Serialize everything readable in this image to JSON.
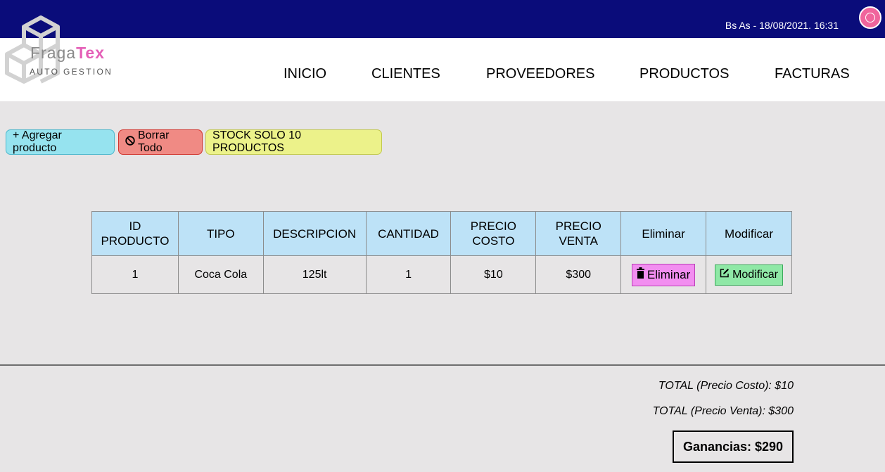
{
  "header": {
    "datetime": "Bs As - 18/08/2021. 16:31",
    "logout_icon": "power-icon",
    "accent_color": "#0a0c7a"
  },
  "logo": {
    "name_part1": "Fraga",
    "name_part2": "Tex",
    "subtitle": "AUTO GESTION"
  },
  "nav": {
    "items": [
      {
        "label": "INICIO"
      },
      {
        "label": "CLIENTES"
      },
      {
        "label": "PROVEEDORES"
      },
      {
        "label": "PRODUCTOS"
      },
      {
        "label": "FACTURAS"
      }
    ]
  },
  "toolbar": {
    "add_label": "+ Agregar producto",
    "clear_icon": "prohibited-icon",
    "clear_label": "Borrar Todo",
    "stock_label": "STOCK SOLO 10 PRODUCTOS"
  },
  "table": {
    "headers": {
      "id_line1": "ID",
      "id_line2": "PRODUCTO",
      "tipo": "TIPO",
      "descripcion": "DESCRIPCION",
      "cantidad": "CANTIDAD",
      "costo_line1": "PRECIO",
      "costo_line2": "COSTO",
      "venta_line1": "PRECIO",
      "venta_line2": "VENTA",
      "eliminar": "Eliminar",
      "modificar": "Modificar"
    },
    "rows": [
      {
        "id": "1",
        "tipo": "Coca Cola",
        "descripcion": "125lt",
        "cantidad": "1",
        "precio_costo": "$10",
        "precio_venta": "$300",
        "delete_label": "Eliminar",
        "delete_icon": "trash-icon",
        "edit_label": "Modificar",
        "edit_icon": "edit-icon"
      }
    ]
  },
  "totals": {
    "cost": "TOTAL (Precio Costo): $10",
    "sale": "TOTAL (Precio Venta): $300",
    "profit": "Ganancias: $290"
  }
}
